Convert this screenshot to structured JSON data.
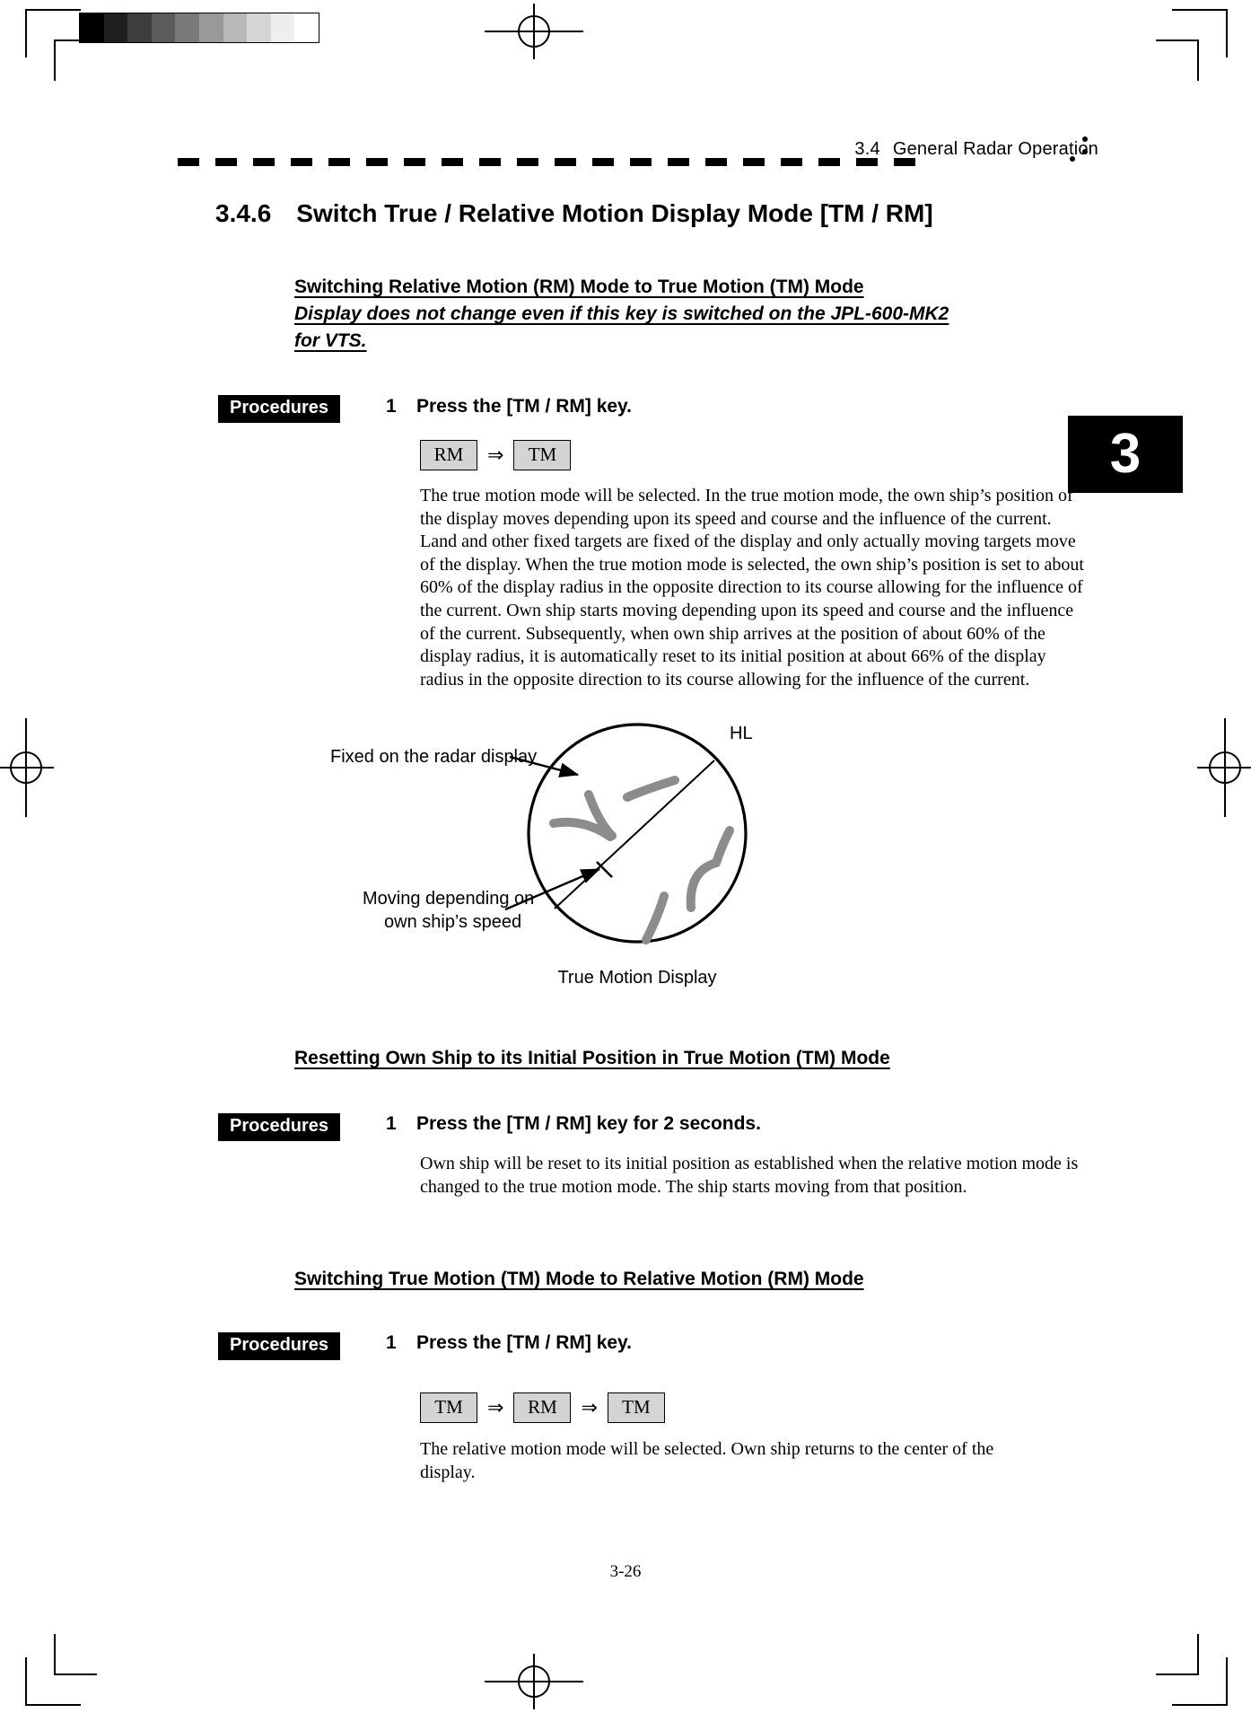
{
  "page": {
    "number": "3-26",
    "chapter_tab": "3",
    "header": {
      "section_number": "3.4",
      "section_title": "General Radar Operation"
    }
  },
  "section": {
    "number": "3.4.6",
    "title": "Switch True / Relative Motion Display Mode [TM / RM]"
  },
  "block1": {
    "heading": "Switching Relative Motion (RM) Mode to True Motion (TM) Mode",
    "note_line1": "Display does not change even if this key is switched on the JPL-600-MK2",
    "note_line2": "for VTS.",
    "procedures_label": "Procedures",
    "step_number": "1",
    "step_text": "Press the [TM / RM] key.",
    "keys": [
      "RM",
      "TM"
    ],
    "key_arrow": "⇒",
    "body": "The true motion mode will be selected.    In the true motion mode, the own ship’s position of the display moves depending upon its speed and course and the influence of the current.    Land and other fixed targets are fixed of the display and only actually moving targets move of the display.    When the true motion mode is selected, the own ship’s position is set to about 60% of the display radius in the opposite direction to its course allowing for the influence of the current.    Own ship starts moving depending upon its speed and course and the influence of the current.    Subsequently, when own ship arrives at the position of about 60% of the display radius, it is automatically reset to its initial position at about 66% of the display radius in the opposite direction to its course allowing for the influence of the current."
  },
  "figure": {
    "caption": "True Motion Display",
    "label_hl": "HL",
    "callout_fixed": "Fixed on the radar display",
    "callout_moving_line1": "Moving depending on",
    "callout_moving_line2": "own ship’s speed"
  },
  "block2": {
    "heading": "Resetting Own Ship to its Initial Position in True Motion (TM) Mode",
    "procedures_label": "Procedures",
    "step_number": "1",
    "step_text": "Press the [TM / RM] key for 2 seconds.",
    "body": "Own ship will be reset to its initial position as established when the relative motion mode is changed to the true motion mode.    The ship starts moving from that position."
  },
  "block3": {
    "heading": "Switching True Motion (TM) Mode to Relative Motion (RM) Mode",
    "procedures_label": "Procedures",
    "step_number": "1",
    "step_text": "Press the [TM / RM] key.",
    "keys": [
      "TM",
      "RM",
      "TM"
    ],
    "key_arrow": "⇒",
    "body": "The relative motion mode will be selected.    Own ship returns to the center of the display."
  },
  "colors": {
    "ink": "#000000",
    "paper": "#ffffff",
    "keycap_fill": "#d4d4d4",
    "target_gray": "#8c8c8c"
  },
  "grayscale_strip": [
    "#000000",
    "#1f1f1f",
    "#3d3d3d",
    "#5c5c5c",
    "#7a7a7a",
    "#999999",
    "#b8b8b8",
    "#d6d6d6",
    "#eeeeee",
    "#ffffff"
  ]
}
